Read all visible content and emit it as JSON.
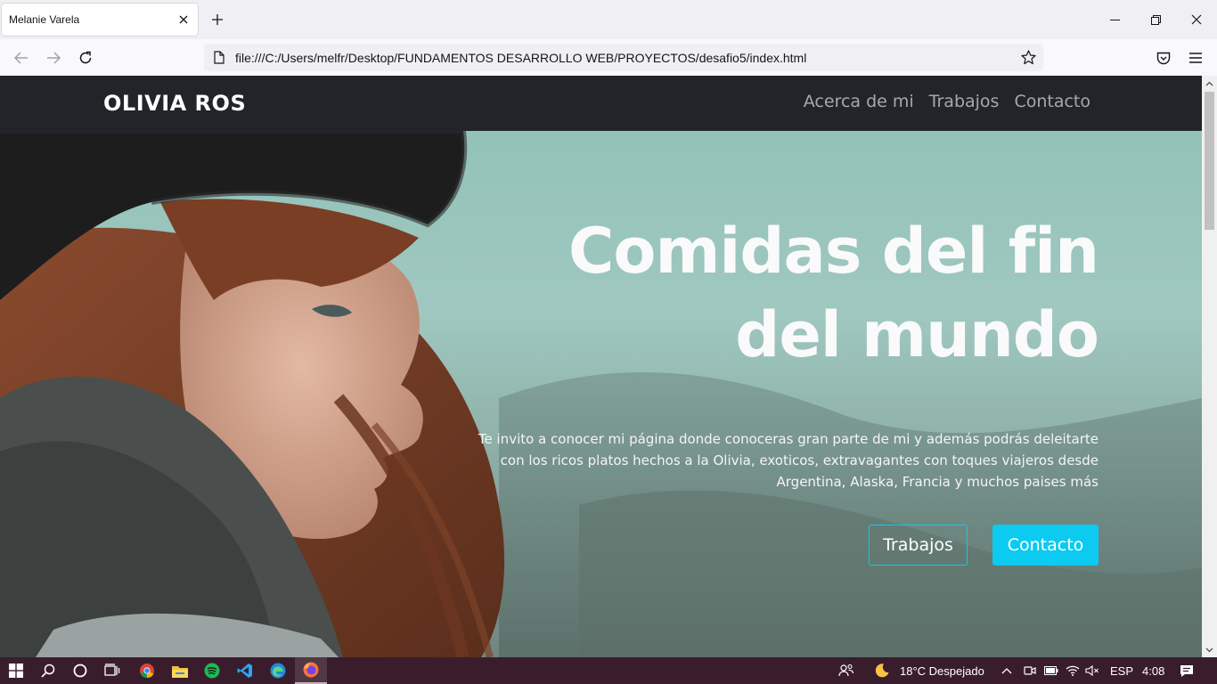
{
  "browser": {
    "tab_title": "Melanie Varela",
    "url": "file:///C:/Users/melfr/Desktop/FUNDAMENTOS DESARROLLO WEB/PROYECTOS/desafio5/index.html"
  },
  "site": {
    "brand": "OLIVIA ROS",
    "nav": [
      "Acerca de mi",
      "Trabajos",
      "Contacto"
    ],
    "hero": {
      "title_line1": "Comidas del fin",
      "title_line2": "del mundo",
      "text": "Te invito a conocer mi página donde conoceras gran parte de mi y además podrás deleitarte con los ricos platos hechos a la Olivia, exoticos, extravagantes con toques viajeros desde Argentina, Alaska, Francia y muchos paises más",
      "button_outline": "Trabajos",
      "button_fill": "Contacto"
    }
  },
  "taskbar": {
    "weather": "18°C  Despejado",
    "lang": "ESP",
    "time": "4:08"
  },
  "colors": {
    "nav_bg": "#212529",
    "accent": "#0dcaf0",
    "taskbar_bg": "#3a1d2c"
  }
}
